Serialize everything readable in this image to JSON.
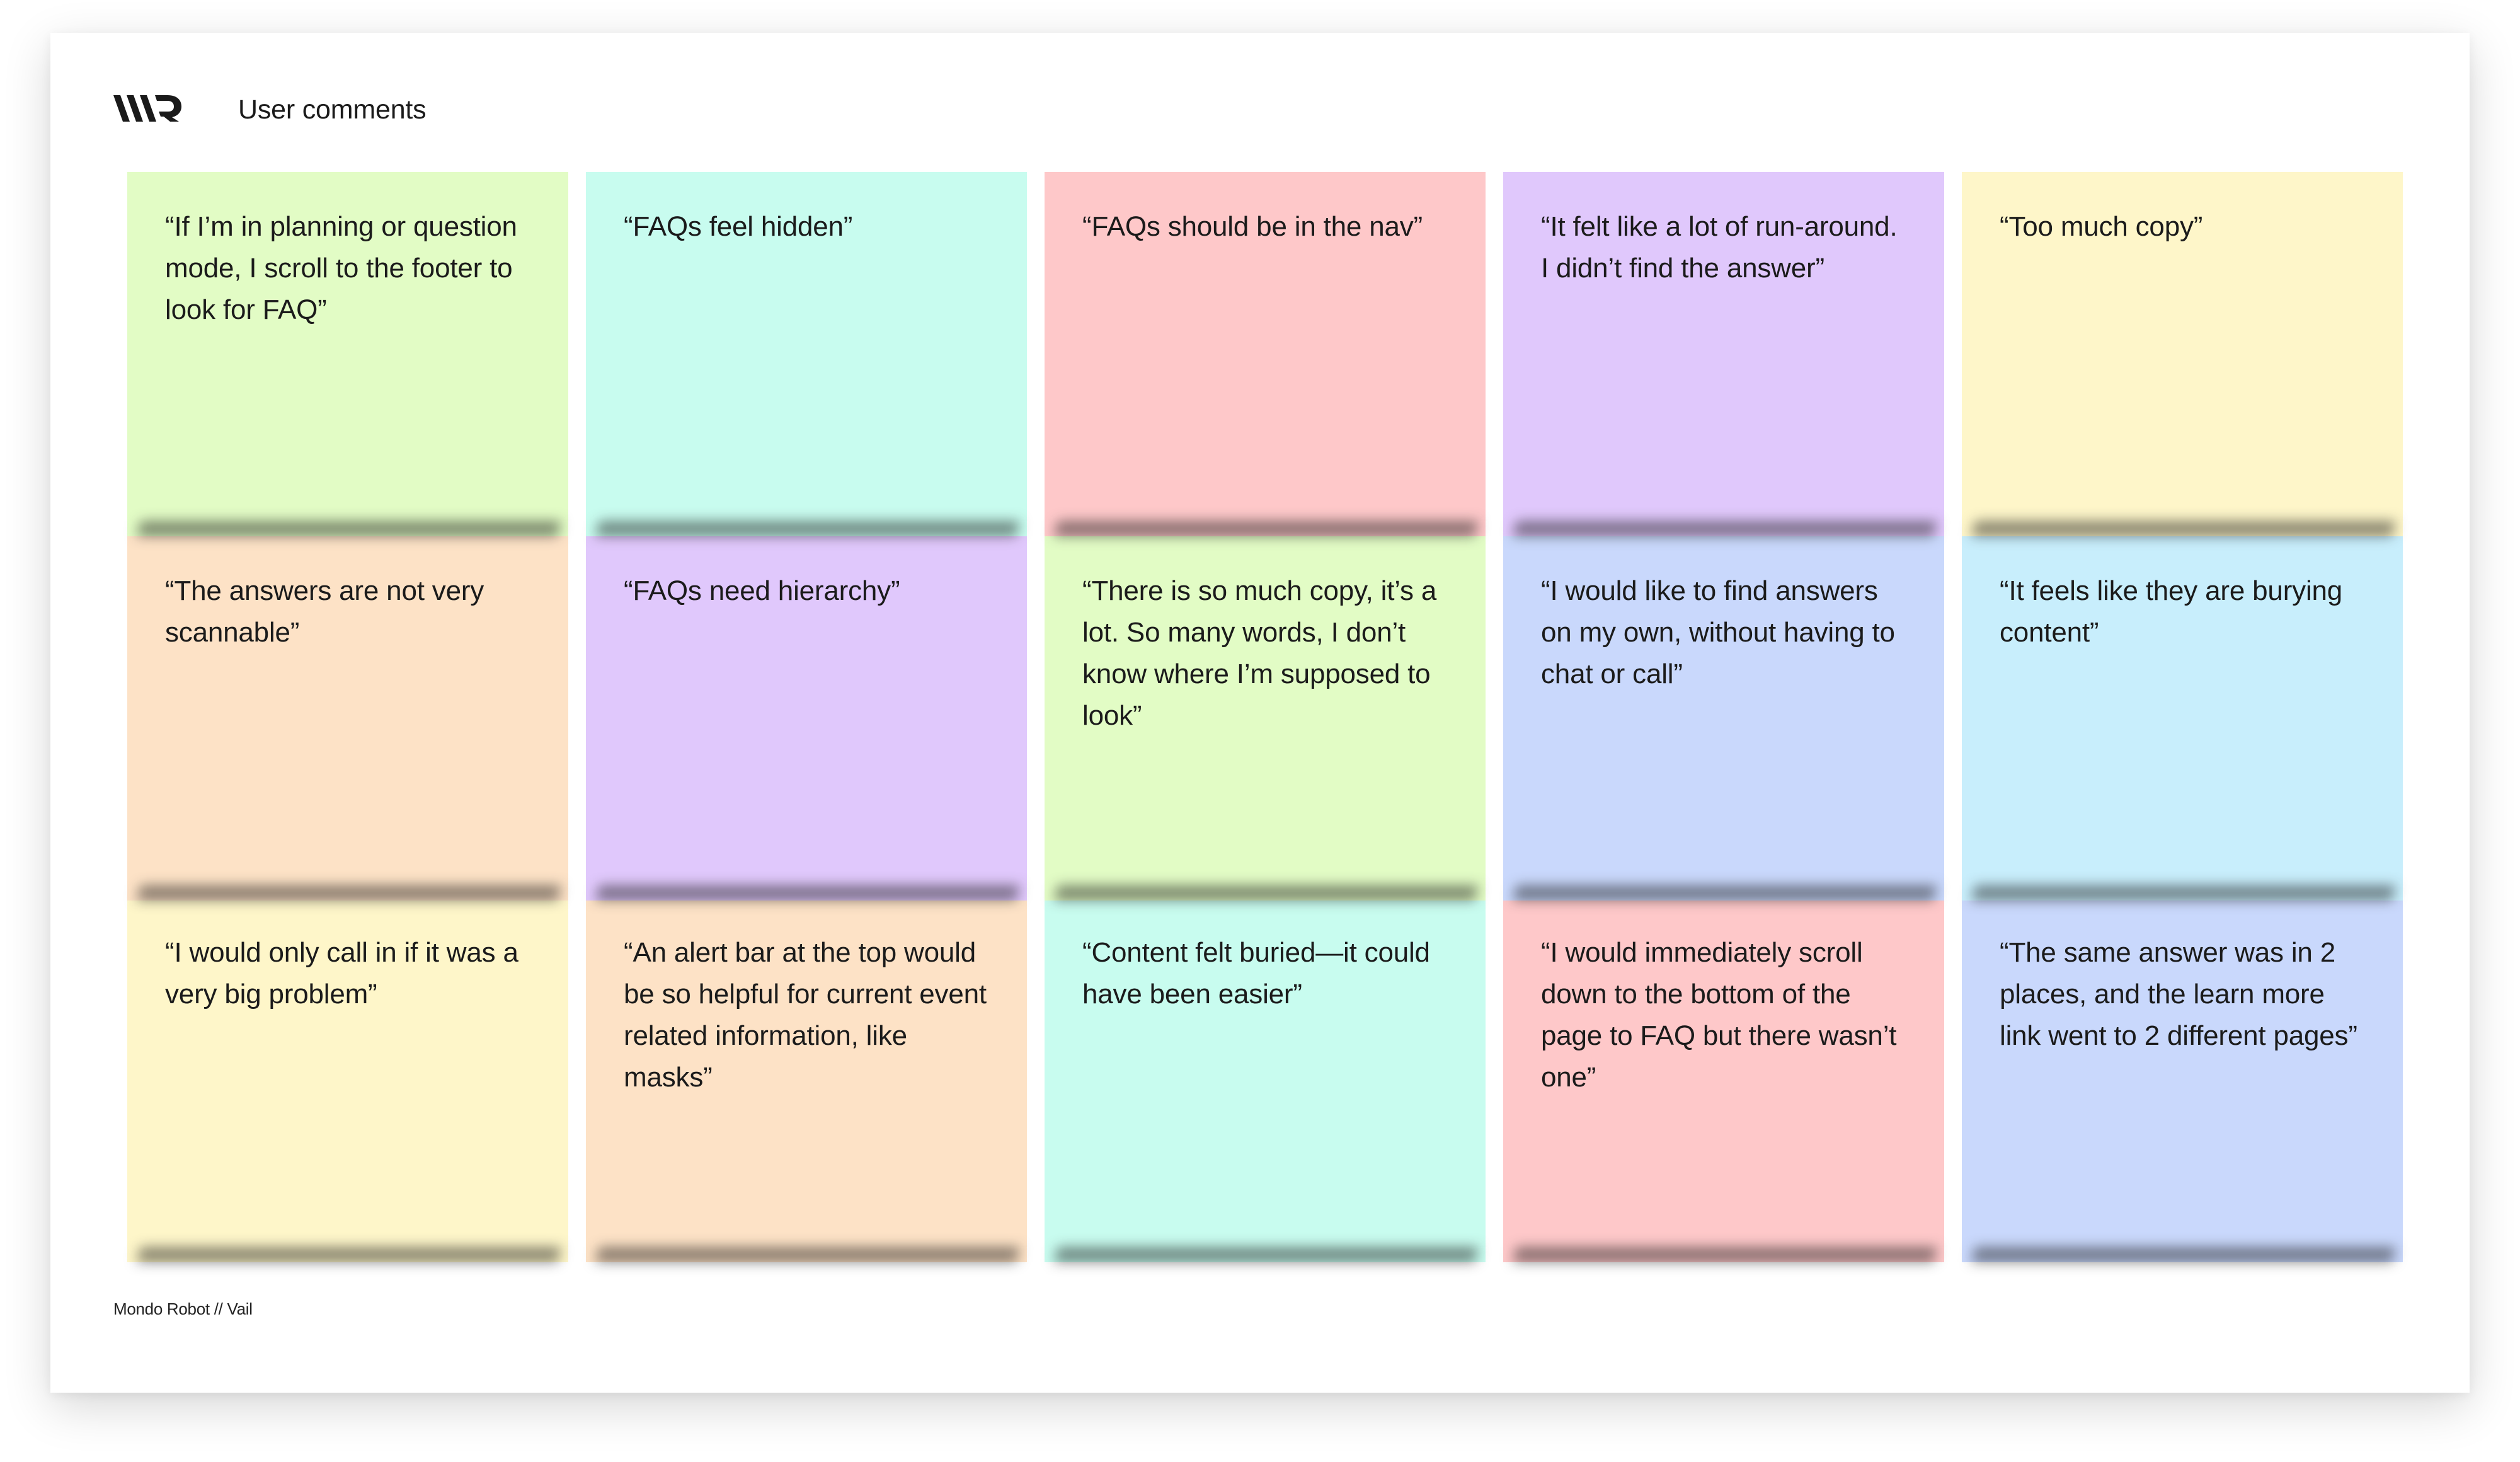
{
  "page": {
    "title": "User comments",
    "footer": "Mondo Robot // Vail",
    "logo_icon": "mondo-robot-logo"
  },
  "colors": {
    "green": "#e2fcc5",
    "mint": "#c8fcef",
    "pink": "#fec8c9",
    "lavender": "#e0c8fc",
    "yellow": "#fef6c9",
    "peach": "#fde2c6",
    "blue": "#c9d8fc",
    "sky": "#c8eefc"
  },
  "notes": [
    {
      "text": "“If I’m in planning or question mode, I scroll to the footer to look for FAQ”",
      "color": "#e2fcc5"
    },
    {
      "text": "“FAQs feel hidden”",
      "color": "#c8fcef"
    },
    {
      "text": "“FAQs should be in the nav”",
      "color": "#fec8c9"
    },
    {
      "text": "“It felt like a lot of run-around. I didn’t find the answer”",
      "color": "#e0c8fc"
    },
    {
      "text": "“Too much copy”",
      "color": "#fef6c9"
    },
    {
      "text": "“The answers are not very scannable”",
      "color": "#fde2c6"
    },
    {
      "text": "“FAQs need hierarchy”",
      "color": "#e0c8fc"
    },
    {
      "text": "“There is so much copy, it’s a lot. So many words, I don’t know where I’m supposed to look”",
      "color": "#e2fcc5"
    },
    {
      "text": "“I would like to find answers on my own, without having to chat or call”",
      "color": "#c9d8fc"
    },
    {
      "text": "“It feels like they are burying content”",
      "color": "#c8eefc"
    },
    {
      "text": "“I would only call in if it was a very big problem”",
      "color": "#fef6c9"
    },
    {
      "text": "“An alert bar at the top would be so helpful for current event related information, like masks”",
      "color": "#fde2c6"
    },
    {
      "text": "“Content felt buried—it could have been easier”",
      "color": "#c8fcef"
    },
    {
      "text": "“I would immediately scroll down to the bottom of the page to FAQ but there wasn’t one”",
      "color": "#fec8c9"
    },
    {
      "text": "“The same answer was in 2 places, and the learn more link went to 2 different pages”",
      "color": "#c9d8fc"
    }
  ]
}
